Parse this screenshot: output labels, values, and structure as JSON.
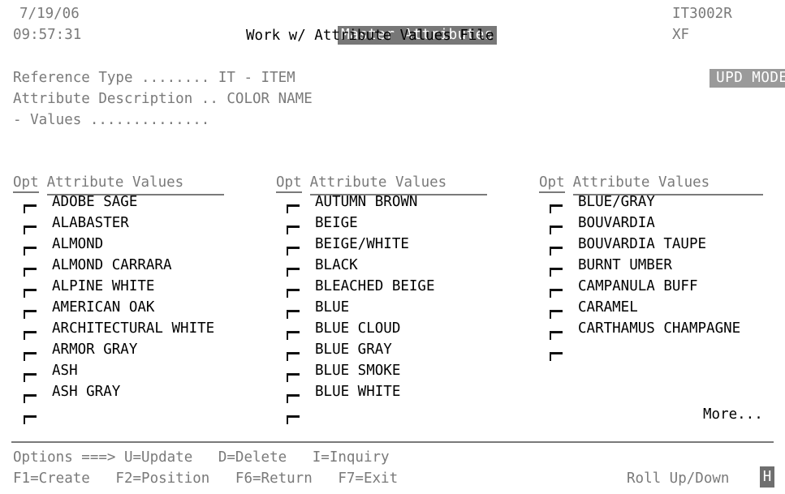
{
  "header": {
    "date": "7/19/06",
    "time": "09:57:31",
    "title": "Master Attributes",
    "subtitle": "Work w/ Attribute Values File",
    "program_id": "IT3002R",
    "workstation": "XF",
    "mode_badge": "UPD MODE"
  },
  "info": {
    "rows": [
      "Reference Type ........ IT - ITEM",
      "Attribute Description .. COLOR NAME",
      "- Values .............."
    ]
  },
  "list": {
    "opt_header": "Opt",
    "values_header": "Attribute Values",
    "columns": [
      {
        "values": [
          "ADOBE SAGE",
          "ALABASTER",
          "ALMOND",
          "ALMOND CARRARA",
          "ALPINE WHITE",
          "AMERICAN OAK",
          "ARCHITECTURAL WHITE",
          "ARMOR GRAY",
          "ASH",
          "ASH GRAY"
        ]
      },
      {
        "values": [
          "AUTUMN BROWN",
          "BEIGE",
          "BEIGE/WHITE",
          "BLACK",
          "BLEACHED BEIGE",
          "BLUE",
          "BLUE CLOUD",
          "BLUE GRAY",
          "BLUE SMOKE",
          "BLUE WHITE"
        ]
      },
      {
        "values": [
          "BLUE/GRAY",
          "BOUVARDIA",
          "BOUVARDIA TAUPE",
          "BURNT UMBER",
          "CAMPANULA BUFF",
          "CARAMEL",
          "CARTHAMUS CHAMPAGNE"
        ]
      }
    ],
    "more_indicator": "More..."
  },
  "footer": {
    "options_line": "Options ===> U=Update   D=Delete   I=Inquiry",
    "function_keys_line": "F1=Create   F2=Position   F6=Return   F7=Exit",
    "roll_hint": "Roll Up/Down",
    "cursor_char": "H"
  },
  "colors": {
    "text_black": "#000000",
    "text_gray": "#7a7a7a",
    "title_bg": "#777777",
    "badge_bg": "#9a9a9a",
    "cursor_bg": "#6f6f6f",
    "background": "#ffffff"
  }
}
